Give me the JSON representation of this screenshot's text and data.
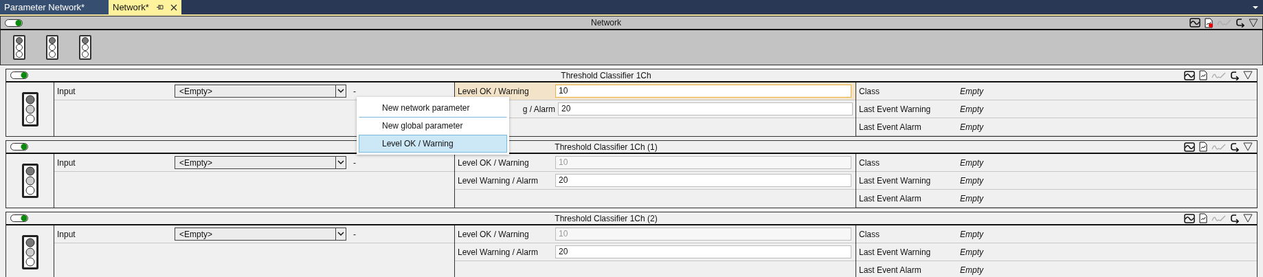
{
  "tabs": [
    {
      "label": "Parameter Network*",
      "selected": false,
      "pinnable": false
    },
    {
      "label": "Network*",
      "selected": true,
      "pinnable": true
    }
  ],
  "network": {
    "title": "Network",
    "on": true,
    "report_flag": true,
    "lights": [
      {
        "kind": "traffic_light"
      },
      {
        "kind": "traffic_light"
      },
      {
        "kind": "traffic_light"
      }
    ]
  },
  "blocks": [
    {
      "title": "Threshold Classifier 1Ch",
      "on": true,
      "input": {
        "label": "Input",
        "value": "<Empty>",
        "unit": "-"
      },
      "levels": [
        {
          "label": "Level OK / Warning",
          "value": "10",
          "focused": true,
          "disabled": false
        },
        {
          "label": "g / Alarm",
          "value": "20",
          "focused": false,
          "disabled": false,
          "partly_hidden": true
        }
      ],
      "outputs": [
        {
          "label": "Class",
          "value": "Empty"
        },
        {
          "label": "Last Event Warning",
          "value": "Empty"
        },
        {
          "label": "Last Event Alarm",
          "value": "Empty"
        }
      ]
    },
    {
      "title": "Threshold Classifier 1Ch (1)",
      "on": true,
      "input": {
        "label": "Input",
        "value": "<Empty>",
        "unit": "-"
      },
      "levels": [
        {
          "label": "Level OK / Warning",
          "value": "10",
          "focused": false,
          "disabled": true
        },
        {
          "label": "Level Warning / Alarm",
          "value": "20",
          "focused": false,
          "disabled": false
        }
      ],
      "outputs": [
        {
          "label": "Class",
          "value": "Empty"
        },
        {
          "label": "Last Event Warning",
          "value": "Empty"
        },
        {
          "label": "Last Event Alarm",
          "value": "Empty"
        }
      ]
    },
    {
      "title": "Threshold Classifier 1Ch (2)",
      "on": true,
      "input": {
        "label": "Input",
        "value": "<Empty>",
        "unit": "-"
      },
      "levels": [
        {
          "label": "Level OK / Warning",
          "value": "10",
          "focused": false,
          "disabled": true
        },
        {
          "label": "Level Warning / Alarm",
          "value": "20",
          "focused": false,
          "disabled": false
        }
      ],
      "outputs": [
        {
          "label": "Class",
          "value": "Empty"
        },
        {
          "label": "Last Event Warning",
          "value": "Empty"
        },
        {
          "label": "Last Event Alarm",
          "value": "Empty"
        }
      ]
    }
  ],
  "context_menu": {
    "items": [
      {
        "label": "New network parameter",
        "selected": false
      },
      {
        "label": "New global parameter",
        "selected": false
      },
      {
        "label": "Level OK / Warning",
        "selected": true
      }
    ]
  }
}
